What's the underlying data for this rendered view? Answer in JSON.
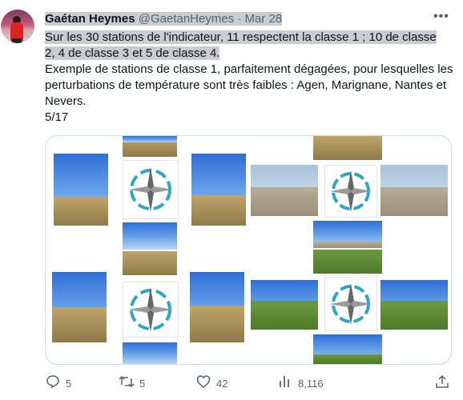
{
  "tweet": {
    "author_name": "Gaétan Heymes",
    "handle": "@GaetanHeymes",
    "separator": "·",
    "date": "Mar 28",
    "text_line1": "Sur les 30 stations de l'indicateur, 11 respectent la classe 1 ; 10 de classe",
    "text_line2": "2, 4 de classe 3 et 5 de classe 4.",
    "text_para2": "Exemple de stations de classe 1, parfaitement dégagées, pour lesquelles les perturbations de température sont très faibles : Agen, Marignane, Nantes et Nevers.",
    "pagination": "5/17",
    "more_icon": "more-horizontal-icon"
  },
  "actions": {
    "replies": "5",
    "retweets": "5",
    "likes": "42",
    "views": "8,116"
  }
}
